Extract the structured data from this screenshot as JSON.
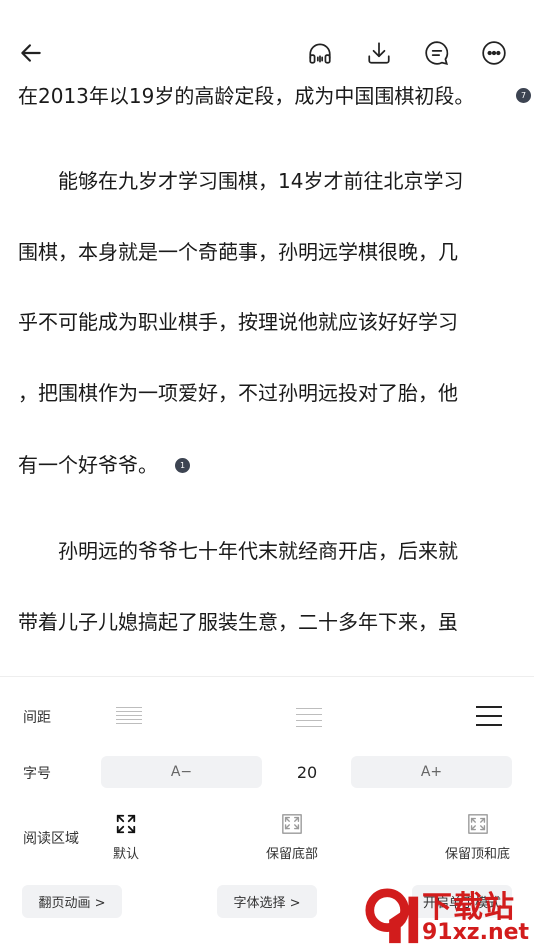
{
  "toolbar": {
    "back_icon": "arrow-left-icon",
    "listen_icon": "headphones-icon",
    "download_icon": "download-icon",
    "comment_icon": "comment-icon",
    "more_icon": "more-icon"
  },
  "reader": {
    "lines": [
      "在2013年以19岁的高龄定段，成为中国围棋初段。",
      "　　能够在九岁才学习围棋，14岁才前往北京学习",
      "围棋，本身就是一个奇葩事，孙明远学棋很晚，几",
      "乎不可能成为职业棋手，按理说他就应该好好学习",
      "，把围棋作为一项爱好，不过孙明远投对了胎，他",
      "有一个好爷爷。",
      "　　孙明远的爷爷七十年代末就经商开店，后来就",
      "带着儿子儿媳搞起了服装生意，二十多年下来，虽"
    ],
    "note_badges": [
      "7",
      "1"
    ]
  },
  "settings": {
    "spacing_label": "间距",
    "font_size_label": "字号",
    "decrease_label": "A−",
    "font_size_value": "20",
    "increase_label": "A+",
    "reading_area_label": "阅读区域",
    "area_options": [
      "默认",
      "保留底部",
      "保留顶和底"
    ],
    "page_animation_label": "翻页动画 >",
    "font_select_label": "字体选择 >",
    "single_hand_label": "开启单手模式"
  },
  "watermark": {
    "line1": "下载站",
    "line2": "91xz.net"
  },
  "colors": {
    "accent_dark": "#222222",
    "button_bg": "#f1f2f4",
    "badge_bg": "#3d4452",
    "watermark_red": "#d21c1c"
  }
}
